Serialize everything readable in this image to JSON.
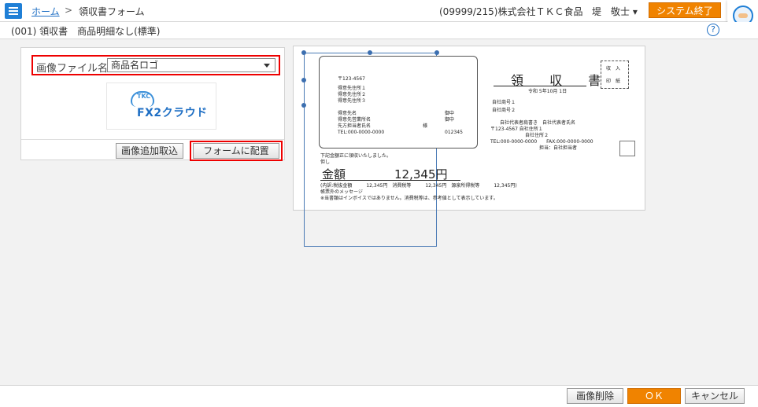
{
  "header": {
    "breadcrumb_home": "ホーム",
    "breadcrumb_sep": ">",
    "breadcrumb_page": "領収書フォーム",
    "company": "(09999/215)株式会社ＴＫＣ食品",
    "user": "堤　敬士 ▾",
    "exit_button": "システム終了"
  },
  "subheader": {
    "title": "(001) 領収書　商品明細なし(標準)",
    "help": "?"
  },
  "image_panel": {
    "file_label": "画像ファイル名",
    "file_value": "商品名ロゴ",
    "logo_small": "TKC",
    "logo_text": "FX2クラウド",
    "import_button": "画像追加取込",
    "place_button": "フォームに配置"
  },
  "preview": {
    "postal": "〒123-4567",
    "addr1": "得意先住所１",
    "addr2": "得意先住所２",
    "addr3": "得意先住所３",
    "cust_name": "得意先名",
    "cust_office": "得意先営業所名",
    "cust_contact": "先方担当者氏名",
    "cust_tel": "TEL:000-0000-0000",
    "onchu1": "御中",
    "onchu2": "御中",
    "sama": "様",
    "code": "012345",
    "title": "領 収 書",
    "date": "令和 5年10月 1日",
    "company1": "自社商号１",
    "company2": "自社商号２",
    "rep": "自社代表者肩書き　自社代表者氏名",
    "own_addr1": "〒123-4567 自社住所１",
    "own_addr2": "自社住所２",
    "own_tel": "TEL:000-0000-0000　　FAX:000-0000-0000",
    "own_staff": "担当：自社担当者",
    "stamp1": "収　入",
    "stamp2": "印　紙",
    "received": "下記金額正に領収いたしました。",
    "tadashi": "但し",
    "amount_label": "金額",
    "amount_value": "12,345円",
    "breakdown": "(内訳:税抜金額　　　12,345円　消費税等　　　12,345円　源泉所得税等　　　12,345円)",
    "message": "帳票外のメッセージ",
    "note": "※当書類はインボイスではありません。消費税等は、参考値として表示しています。"
  },
  "footer": {
    "delete_button": "画像削除",
    "ok_button": "ＯＫ",
    "cancel_button": "キャンセル"
  },
  "colors": {
    "accent": "#1f7fd6",
    "orange": "#f08300",
    "highlight": "#e00000"
  }
}
